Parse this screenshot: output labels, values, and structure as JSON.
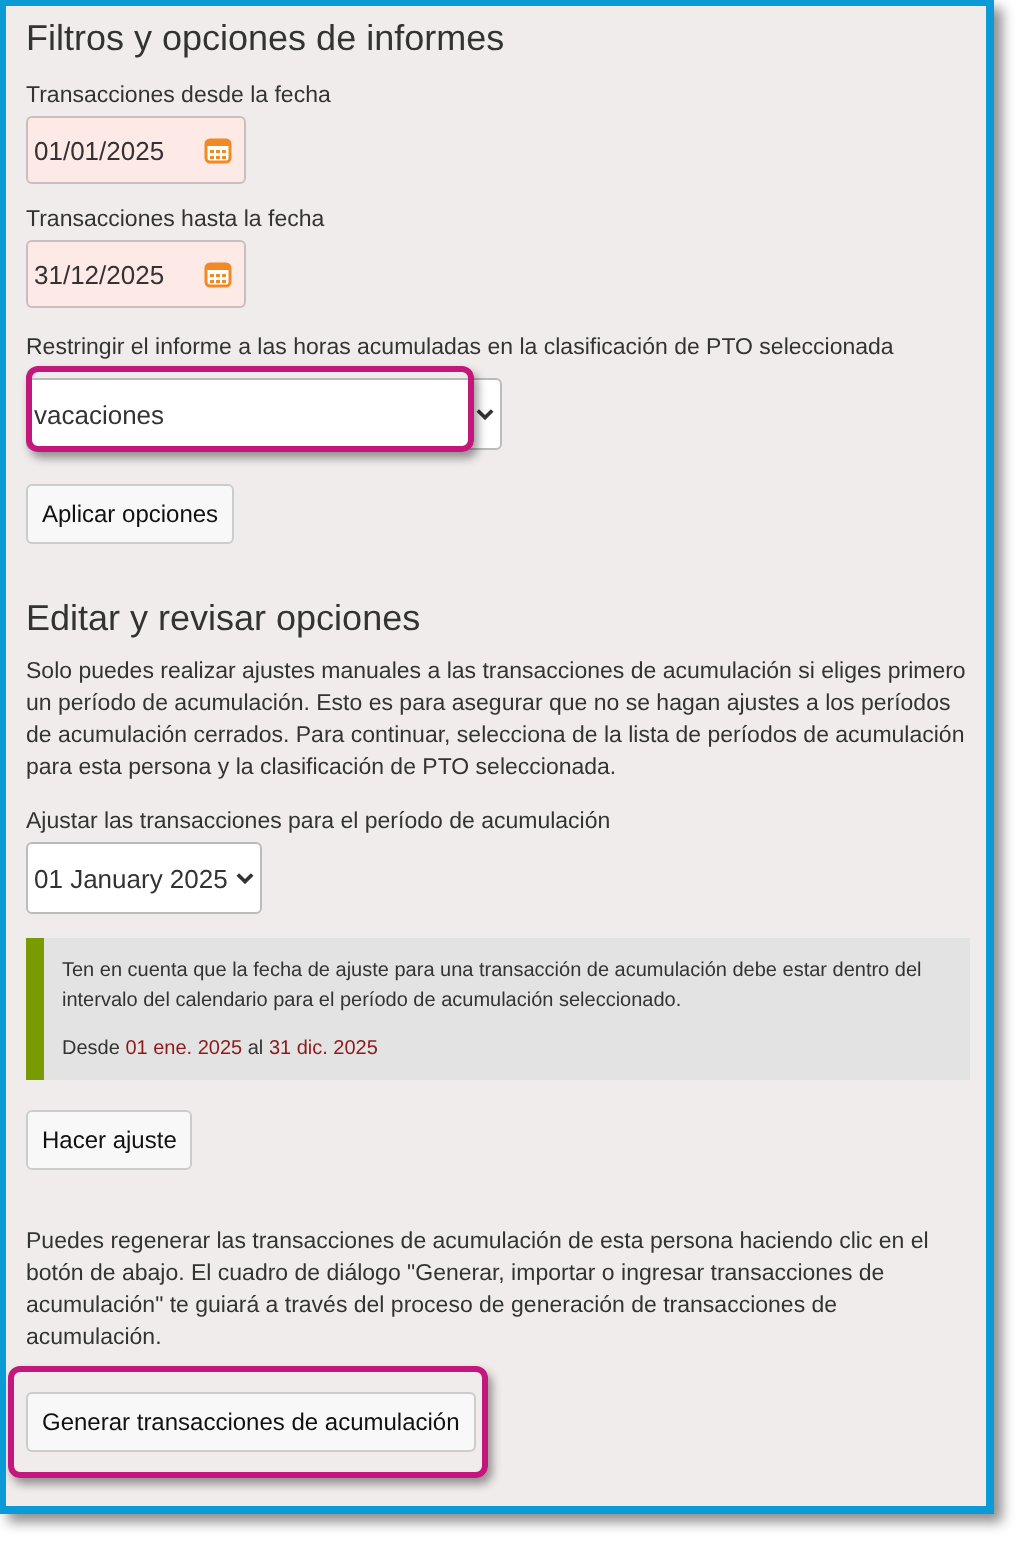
{
  "filters": {
    "title": "Filtros y opciones de informes",
    "from_date": {
      "label": "Transacciones desde la fecha",
      "value": "01/01/2025"
    },
    "to_date": {
      "label": "Transacciones hasta la fecha",
      "value": "31/12/2025"
    },
    "classification": {
      "label": "Restringir el informe a las horas acumuladas en la clasificación de PTO seleccionada",
      "value": "vacaciones",
      "highlighted": true
    },
    "apply_button": {
      "label": "Aplicar opciones"
    }
  },
  "edit": {
    "title": "Editar y revisar opciones",
    "intro": "Solo puedes realizar ajustes manuales a las transacciones de acumulación si eliges primero un período de acumulación. Esto es para asegurar que no se hagan ajustes a los períodos de acumulación cerrados. Para continuar, selecciona de la lista de períodos de acumulación para esta persona y la clasificación de PTO seleccionada.",
    "period": {
      "label": "Ajustar las transacciones para el período de acumulación",
      "value": "01 January 2025"
    },
    "note": {
      "text": "Ten en cuenta que la fecha de ajuste para una transacción de acumulación debe estar dentro del intervalo del calendario para el período de acumulación seleccionado.",
      "range_prefix": "Desde",
      "range_start": "01 ene. 2025",
      "range_joiner": "al",
      "range_end": "31 dic. 2025"
    },
    "adjust_button": {
      "label": "Hacer ajuste"
    },
    "regen_text": "Puedes regenerar las transacciones de acumulación de esta persona haciendo clic en el botón de abajo. El cuadro de diálogo \"Generar, importar o ingresar transacciones de acumulación\" te guiará a través del proceso de generación de transacciones de acumulación.",
    "generate_button": {
      "label": "Generar transacciones de acumulación",
      "highlighted": true
    }
  }
}
